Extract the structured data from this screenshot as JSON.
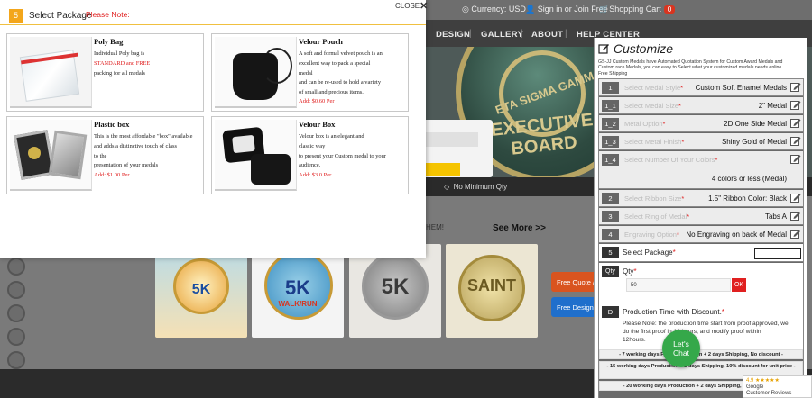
{
  "site": {
    "currency_label": "Currency:",
    "currency_value": "USD",
    "sign_in": "Sign in or Join Free",
    "cart_label": "Shopping Cart",
    "cart_count": "0",
    "nav": [
      "DESIGN",
      "GALLERY",
      "ABOUT",
      "HELP CENTER"
    ],
    "hero_medal_line1": "ETA SIGMA GAMMA",
    "hero_medal_line2": "EXECUTIVE BOARD",
    "min_qty": "No Minimum Qty",
    "them_text": "HEM!",
    "see_more": "See More >>",
    "thumb_labels": [
      "5K",
      "5K",
      "5K",
      "5K"
    ],
    "thumb_banners": [
      "",
      "RUNNING LIKE FLYING",
      "",
      ""
    ],
    "thumb_subtexts": [
      "",
      "WALK/RUN",
      "",
      "SAINT"
    ],
    "free_quote": "Free Quote /",
    "free_design": "Free Design +"
  },
  "package_modal": {
    "step": "5",
    "title": "Select Package",
    "note": "Please Note:",
    "close": "CLOSE",
    "options": [
      {
        "name": "Poly Bag",
        "desc": [
          "Individual Poly bag is",
          "STANDARD and FREE",
          "packing for all medals"
        ],
        "price": ""
      },
      {
        "name": "Velour Pouch",
        "desc": [
          "A soft and formal velvet pouch is an",
          "excellent way to pack a special",
          "medal",
          "and can be re-used to hold a variety",
          "of small and precious items."
        ],
        "price": "Add: $0.60 Per"
      },
      {
        "name": "Plastic box",
        "desc": [
          "This is the most affordable \"box\" available",
          "and adds a distinctive touch of class",
          "to the",
          "presentation of your medals"
        ],
        "price": "Add: $1.00 Per"
      },
      {
        "name": "Velour Box",
        "desc": [
          "Velour box is an elegant and",
          "classic way",
          "to present your Custom  medal to your",
          "audience."
        ],
        "price": "Add: $3.0 Per"
      }
    ]
  },
  "customize": {
    "title": "Customize",
    "intro": [
      "GS-JJ Custom Medals have Automated Quotation System for Custom Award Medals and",
      "Custom race Medals, you can easy to Select what your customized medals needs online.",
      "Free Shipping"
    ],
    "steps": [
      {
        "num": "1",
        "label": "Select Medal Style",
        "value": "Custom Soft Enamel Medals"
      },
      {
        "num": "1_1",
        "label": "Select Medal Size",
        "value": "2\" Medal"
      },
      {
        "num": "1_2",
        "label": "Metal Option",
        "value": "2D One Side Medal"
      },
      {
        "num": "1_3",
        "label": "Select Metal Finish",
        "value": "Shiny Gold of Medal"
      },
      {
        "num": "1_4",
        "label": "Select Number Of Your Colors",
        "value": "4 colors or less (Medal)"
      },
      {
        "num": "2",
        "label": "Select Ribbon Size",
        "value": "1.5\" Ribbon Color: Black"
      },
      {
        "num": "3",
        "label": "Select Ring of Medal",
        "value": "Tabs A"
      },
      {
        "num": "4",
        "label": "Engraving Option",
        "value": "No Engraving on back of Medal"
      }
    ],
    "step5_num": "5",
    "step5_label": "Select Package",
    "qty_num": "Qty",
    "qty_label": "Qty",
    "qty_value": "50",
    "ok": "OK",
    "prod_num": "D",
    "prod_title": "Production Time with Discount.",
    "prod_note": [
      "Please Note: the production time start from proof approved, we",
      "do the first proof in 12 hours, and modify proof within",
      "12hours."
    ],
    "options": [
      "- 7 working days FAST Production + 2 days Shipping, No discount -",
      "- 15 working days Production + 2 days Shipping, 10% discount for unit price -",
      "- 20 working days Production + 2 days Shipping, 20% discount -"
    ]
  },
  "chat": {
    "line1": "Let's",
    "line2": "Chat"
  },
  "reviews": {
    "score": "4.9 ★★★★★",
    "line1": "Google",
    "line2": "Customer Reviews"
  }
}
